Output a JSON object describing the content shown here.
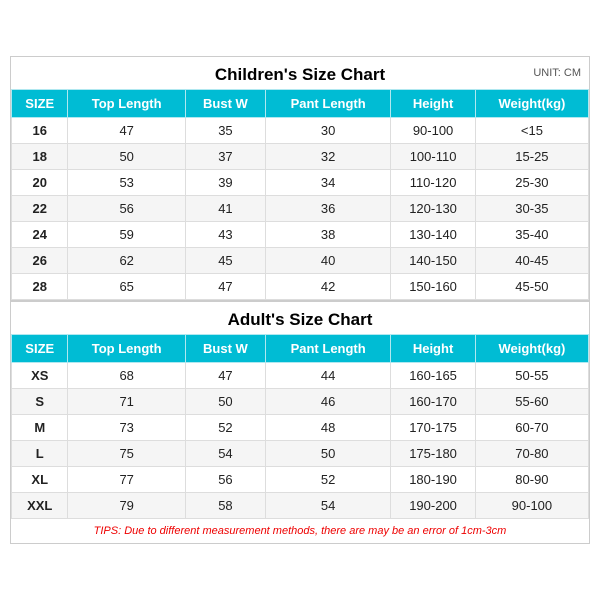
{
  "children": {
    "title": "Children's Size Chart",
    "unit": "UNIT: CM",
    "columns": [
      "SIZE",
      "Top Length",
      "Bust W",
      "Pant Length",
      "Height",
      "Weight(kg)"
    ],
    "rows": [
      [
        "16",
        "47",
        "35",
        "30",
        "90-100",
        "<15"
      ],
      [
        "18",
        "50",
        "37",
        "32",
        "100-110",
        "15-25"
      ],
      [
        "20",
        "53",
        "39",
        "34",
        "110-120",
        "25-30"
      ],
      [
        "22",
        "56",
        "41",
        "36",
        "120-130",
        "30-35"
      ],
      [
        "24",
        "59",
        "43",
        "38",
        "130-140",
        "35-40"
      ],
      [
        "26",
        "62",
        "45",
        "40",
        "140-150",
        "40-45"
      ],
      [
        "28",
        "65",
        "47",
        "42",
        "150-160",
        "45-50"
      ]
    ]
  },
  "adult": {
    "title": "Adult's Size Chart",
    "columns": [
      "SIZE",
      "Top Length",
      "Bust W",
      "Pant Length",
      "Height",
      "Weight(kg)"
    ],
    "rows": [
      [
        "XS",
        "68",
        "47",
        "44",
        "160-165",
        "50-55"
      ],
      [
        "S",
        "71",
        "50",
        "46",
        "160-170",
        "55-60"
      ],
      [
        "M",
        "73",
        "52",
        "48",
        "170-175",
        "60-70"
      ],
      [
        "L",
        "75",
        "54",
        "50",
        "175-180",
        "70-80"
      ],
      [
        "XL",
        "77",
        "56",
        "52",
        "180-190",
        "80-90"
      ],
      [
        "XXL",
        "79",
        "58",
        "54",
        "190-200",
        "90-100"
      ]
    ]
  },
  "tips": "TIPS: Due to different measurement methods, there are may be an error of 1cm-3cm"
}
